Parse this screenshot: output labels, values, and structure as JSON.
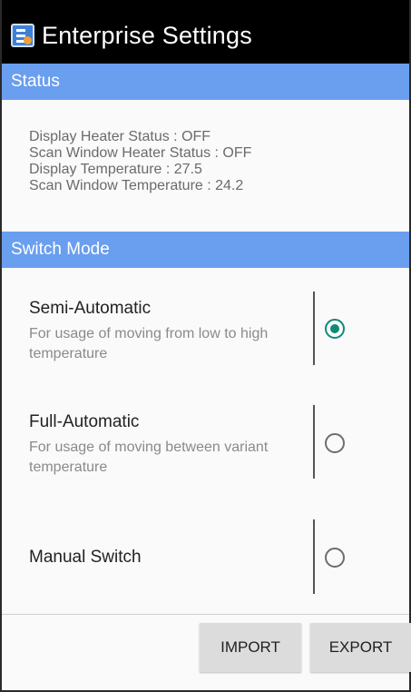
{
  "app": {
    "title": "Enterprise Settings",
    "icon": "settings-app-icon"
  },
  "status": {
    "header": "Status",
    "lines": [
      "Display Heater Status : OFF",
      "Scan Window Heater Status : OFF",
      "Display Temperature : 27.5",
      "Scan Window Temperature : 24.2"
    ]
  },
  "switch_mode": {
    "header": "Switch Mode",
    "options": [
      {
        "title": "Semi-Automatic",
        "description": "For usage of moving from low to high temperature",
        "selected": true
      },
      {
        "title": "Full-Automatic",
        "description": "For usage of moving between variant temperature",
        "selected": false
      },
      {
        "title": "Manual Switch",
        "description": "",
        "selected": false
      }
    ]
  },
  "buttons": {
    "import": "IMPORT",
    "export": "EXPORT"
  },
  "colors": {
    "header_bg": "#6a9eef",
    "titlebar_bg": "#000000",
    "radio_accent": "#0f8a7a",
    "button_bg": "#dcdcdc"
  }
}
